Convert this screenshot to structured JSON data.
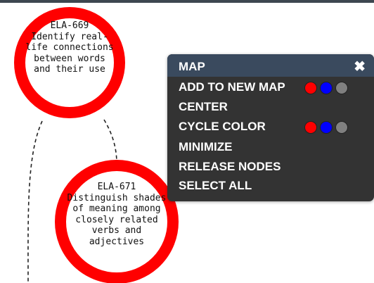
{
  "nodes": [
    {
      "code": "ELA-669",
      "desc": "Identify real-life connections between words and their use"
    },
    {
      "code": "ELA-671",
      "desc": "Distinguish shades of meaning among closely related verbs and adjectives"
    }
  ],
  "menu": {
    "title": "MAP",
    "close": "✖",
    "items": [
      {
        "label": "ADD TO NEW MAP",
        "colors": [
          "#ff0000",
          "#0000ff",
          "#808080"
        ]
      },
      {
        "label": "CENTER"
      },
      {
        "label": "CYCLE COLOR",
        "colors": [
          "#ff0000",
          "#0000ff",
          "#808080"
        ]
      },
      {
        "label": "MINIMIZE"
      },
      {
        "label": "RELEASE NODES"
      },
      {
        "label": "SELECT ALL"
      }
    ]
  }
}
